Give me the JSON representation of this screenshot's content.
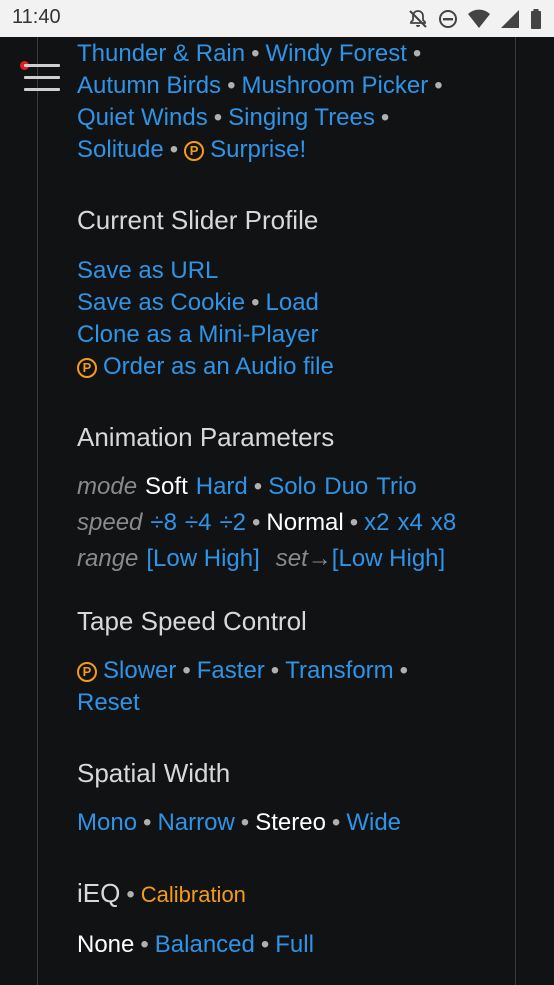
{
  "status": {
    "time": "11:40"
  },
  "presets": {
    "line1": [
      "Thunder & Rain",
      "Windy Forest"
    ],
    "line2": [
      "Autumn Birds",
      "Mushroom Picker"
    ],
    "line3": [
      "Quiet Winds",
      "Singing Trees"
    ],
    "line4_a": "Solitude",
    "line4_b": "Surprise!",
    "coin_glyph": "P"
  },
  "profile": {
    "heading": "Current Slider Profile",
    "save_url": "Save as URL",
    "save_cookie": "Save as Cookie",
    "load": "Load",
    "clone": "Clone as a Mini-Player",
    "order": "Order as an Audio file"
  },
  "animation": {
    "heading": "Animation Parameters",
    "mode_label": "mode",
    "mode_soft": "Soft",
    "mode_hard": "Hard",
    "mode_solo": "Solo",
    "mode_duo": "Duo",
    "mode_trio": "Trio",
    "speed_label": "speed",
    "speed_div8": "÷8",
    "speed_div4": "÷4",
    "speed_div2": "÷2",
    "speed_normal": "Normal",
    "speed_x2": "x2",
    "speed_x4": "x4",
    "speed_x8": "x8",
    "range_label": "range",
    "range_value": "[Low High]",
    "set_label": "set→",
    "set_value": "[Low High]"
  },
  "tape": {
    "heading": "Tape Speed Control",
    "slower": "Slower",
    "faster": "Faster",
    "transform": "Transform",
    "reset": "Reset"
  },
  "spatial": {
    "heading": "Spatial Width",
    "mono": "Mono",
    "narrow": "Narrow",
    "stereo": "Stereo",
    "wide": "Wide"
  },
  "ieq": {
    "heading": "iEQ",
    "calibration": "Calibration",
    "none": "None",
    "balanced": "Balanced",
    "full": "Full"
  },
  "separator": "•",
  "colors": {
    "link": "#2f93e6",
    "accent": "#f39c1a",
    "background": "#111214",
    "menu_dot": "#e02020"
  }
}
